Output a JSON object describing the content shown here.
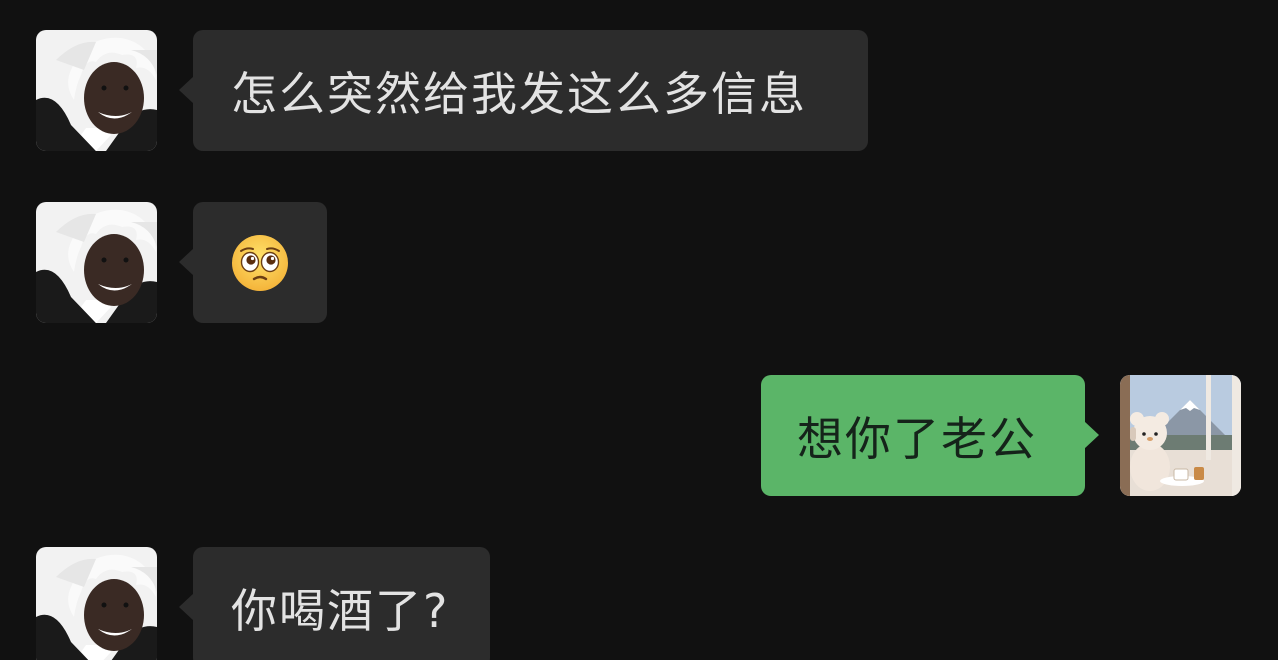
{
  "messages": [
    {
      "sender": "other",
      "text": "怎么突然给我发这么多信息"
    },
    {
      "sender": "other",
      "emoji": "face-with-pleading-eyes"
    },
    {
      "sender": "self",
      "text": "想你了老公"
    },
    {
      "sender": "other",
      "text": "你喝酒了?"
    }
  ],
  "colors": {
    "background": "#111111",
    "incoming_bubble": "#2c2c2c",
    "outgoing_bubble": "#5bb568",
    "incoming_text": "#e3e3e3",
    "outgoing_text": "#15231a"
  }
}
